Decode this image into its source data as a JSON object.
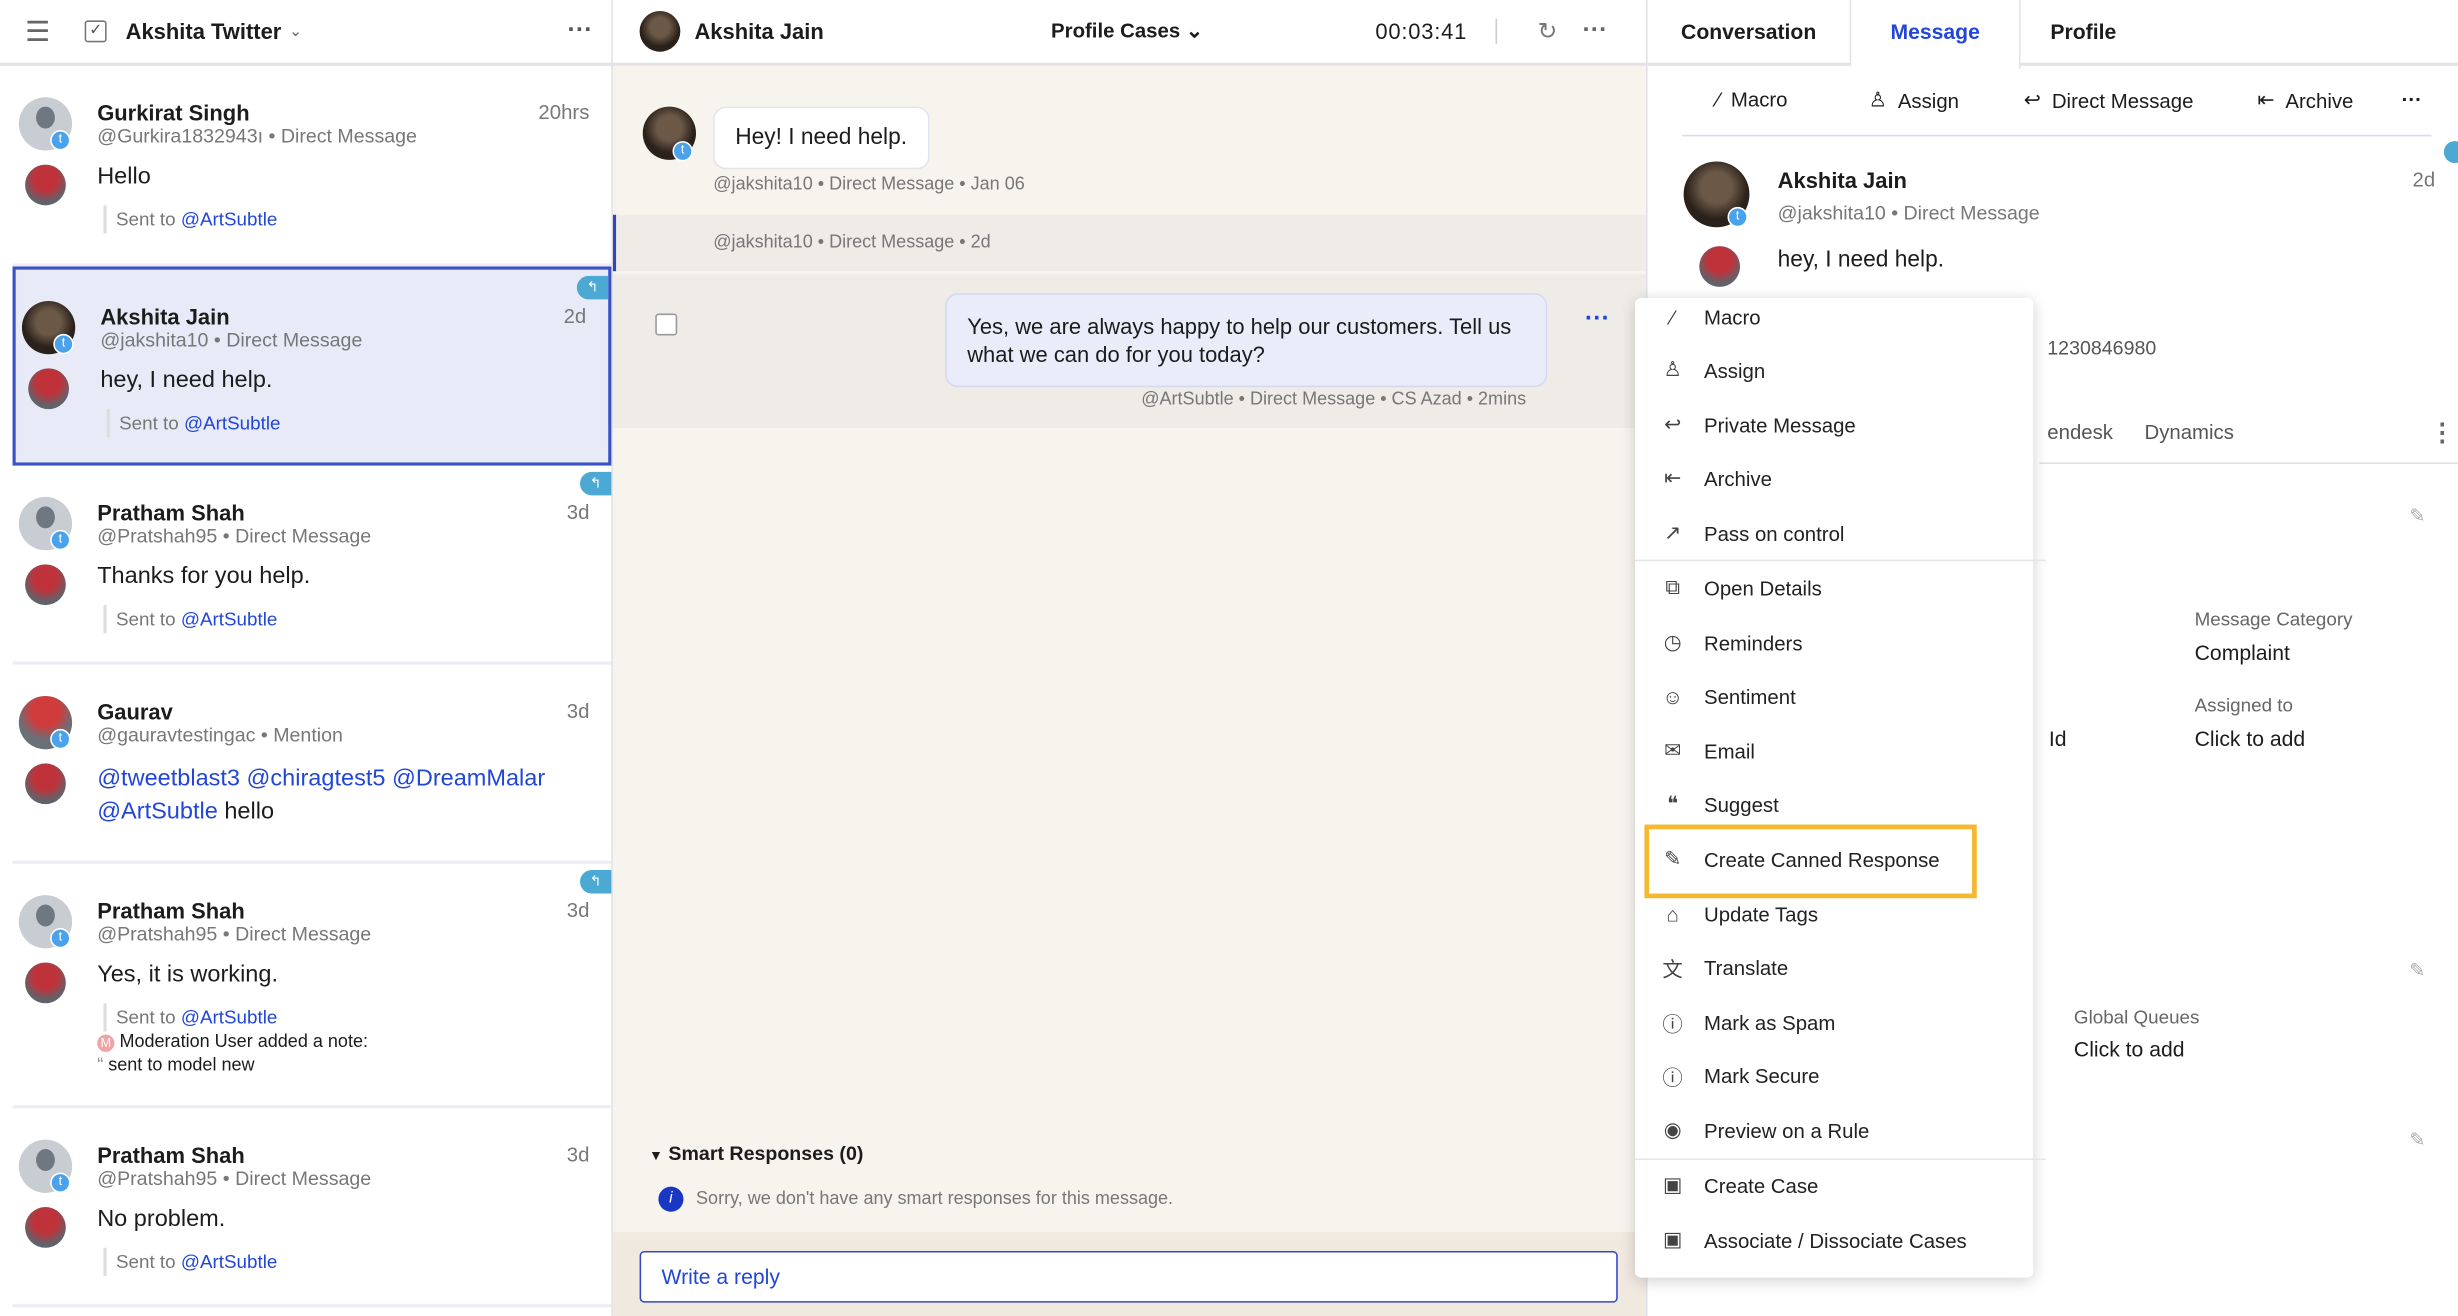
{
  "left": {
    "title": "Akshita Twitter",
    "items": [
      {
        "name": "Gurkirat Singh",
        "handle": "@Gurkira1832943ı",
        "type": "Direct Message",
        "time": "20hrs",
        "text": "Hello",
        "sent_label": "Sent to",
        "sent_to": "@ArtSubtle",
        "avatar": "gray",
        "reply_tag": false
      },
      {
        "name": "Akshita Jain",
        "handle": "@jakshita10",
        "type": "Direct Message",
        "time": "2d",
        "text": "hey, I need help.",
        "sent_label": "Sent to",
        "sent_to": "@ArtSubtle",
        "avatar": "photo",
        "reply_tag": true,
        "selected": true
      },
      {
        "name": "Pratham Shah",
        "handle": "@Pratshah95",
        "type": "Direct Message",
        "time": "3d",
        "text": "Thanks for you help.",
        "sent_label": "Sent to",
        "sent_to": "@ArtSubtle",
        "avatar": "gray",
        "reply_tag": true
      },
      {
        "name": "Gaurav",
        "handle": "@gauravtestingac",
        "type": "Mention",
        "time": "3d",
        "text_links": "@tweetblast3 @chiragtest5 @DreamMalar",
        "text_link2": "@ArtSubtle",
        "text": "hello",
        "avatar": "flower",
        "reply_tag": false
      },
      {
        "name": "Pratham Shah",
        "handle": "@Pratshah95",
        "type": "Direct Message",
        "time": "3d",
        "text": "Yes, it is working.",
        "sent_label": "Sent to",
        "sent_to": "@ArtSubtle",
        "avatar": "gray",
        "reply_tag": true,
        "note_author": "Moderation User added a note:",
        "note_text": "sent to model new"
      },
      {
        "name": "Pratham Shah",
        "handle": "@Pratshah95",
        "type": "Direct Message",
        "time": "3d",
        "text": "No problem.",
        "sent_label": "Sent to",
        "sent_to": "@ArtSubtle",
        "avatar": "gray",
        "reply_tag": false
      }
    ]
  },
  "mid": {
    "name": "Akshita Jain",
    "dropdown": "Profile Cases",
    "timer": "00:03:41",
    "msg1": {
      "text": "Hey! I need help.",
      "meta": "@jakshita10 • Direct Message • Jan 06"
    },
    "msg2": {
      "meta": "@jakshita10 • Direct Message • 2d"
    },
    "msg3": {
      "text": "Yes, we are always happy to help our customers. Tell us what we can do for you today?",
      "meta": "@ArtSubtle • Direct Message • CS Azad • 2mins"
    },
    "smart": {
      "title": "Smart Responses (0)",
      "empty": "Sorry, we don't have any smart responses for this message."
    },
    "reply_placeholder": "Write a reply"
  },
  "right": {
    "tabs": [
      "Conversation",
      "Message",
      "Profile"
    ],
    "active_tab": "Message",
    "actions": [
      "Macro",
      "Assign",
      "Direct Message",
      "Archive"
    ],
    "card": {
      "name": "Akshita Jain",
      "handle": "@jakshita10 • Direct Message",
      "time": "2d",
      "text": "hey, I need help."
    },
    "bg": {
      "number": "1230846980",
      "tab_a": "endesk",
      "tab_b": "Dynamics",
      "cat_label": "Message Category",
      "cat_value": "Complaint",
      "assigned_label": "Assigned to",
      "assigned_value": "Click to add",
      "id_label": "Id",
      "gq_label": "Global Queues",
      "gq_value": "Click to add"
    }
  },
  "menu": {
    "highlighted": "Create Canned Response",
    "highlight_color": "#f5b82e",
    "items": [
      {
        "label": "Macro",
        "icon": "magic-wand"
      },
      {
        "label": "Assign",
        "icon": "assign-person"
      },
      {
        "label": "Private Message",
        "icon": "reply-arrow"
      },
      {
        "label": "Archive",
        "icon": "archive"
      },
      {
        "label": "Pass on control",
        "icon": "external-arrow"
      },
      {
        "label": "Open Details",
        "icon": "open-window"
      },
      {
        "label": "Reminders",
        "icon": "stopwatch"
      },
      {
        "label": "Sentiment",
        "icon": "smiley"
      },
      {
        "label": "Email",
        "icon": "envelope"
      },
      {
        "label": "Suggest",
        "icon": "quote"
      },
      {
        "label": "Create Canned Response",
        "icon": "edit-square"
      },
      {
        "label": "Update Tags",
        "icon": "tag"
      },
      {
        "label": "Translate",
        "icon": "translate"
      },
      {
        "label": "Mark as Spam",
        "icon": "alert-circle"
      },
      {
        "label": "Mark Secure",
        "icon": "alert-circle"
      },
      {
        "label": "Preview on a Rule",
        "icon": "eye"
      },
      {
        "label": "Create Case",
        "icon": "case"
      },
      {
        "label": "Associate / Dissociate Cases",
        "icon": "case"
      }
    ]
  }
}
